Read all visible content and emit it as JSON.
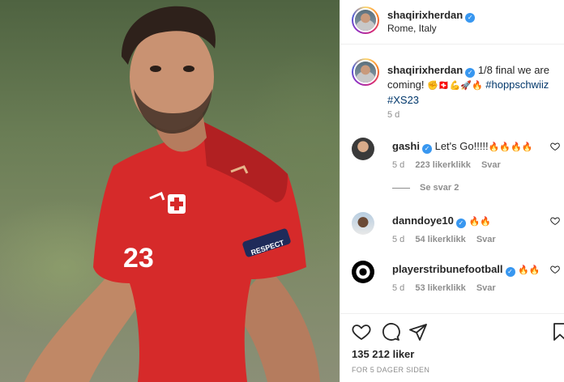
{
  "header": {
    "username": "shaqirixherdan",
    "location": "Rome, Italy"
  },
  "caption": {
    "username": "shaqirixherdan",
    "text": "1/8 final we are coming!",
    "emojis": "✊🇨🇭💪🚀🔥",
    "hashtag1": "#hoppschwiiz",
    "hashtag2": "#XS23",
    "time": "5 d"
  },
  "comments": [
    {
      "username": "gashi",
      "text": "Let's Go!!!!!",
      "emojis": "🔥🔥🔥🔥",
      "time": "5 d",
      "likes": "223 likerklikk",
      "reply": "Svar"
    },
    {
      "username": "danndoye10",
      "text": "",
      "emojis": "🔥🔥",
      "time": "5 d",
      "likes": "54 likerklikk",
      "reply": "Svar"
    },
    {
      "username": "playerstribunefootball",
      "text": "",
      "emojis": "🔥🔥",
      "time": "5 d",
      "likes": "53 likerklikk",
      "reply": "Svar"
    }
  ],
  "view_replies": "Se svar 2",
  "footer": {
    "likes": "135 212 liker",
    "age": "FOR 5 DAGER SIDEN"
  },
  "photo": {
    "jersey_number": "23",
    "badge_text": "RESPECT"
  },
  "icons": {
    "like": "heart-icon",
    "comment": "comment-icon",
    "share": "share-icon",
    "save": "bookmark-icon",
    "verified": "verified-badge-icon"
  },
  "colors": {
    "verified": "#3897f0",
    "hashtag": "#00376b",
    "jersey": "#d62a2a",
    "muted": "#8e8e8e"
  }
}
